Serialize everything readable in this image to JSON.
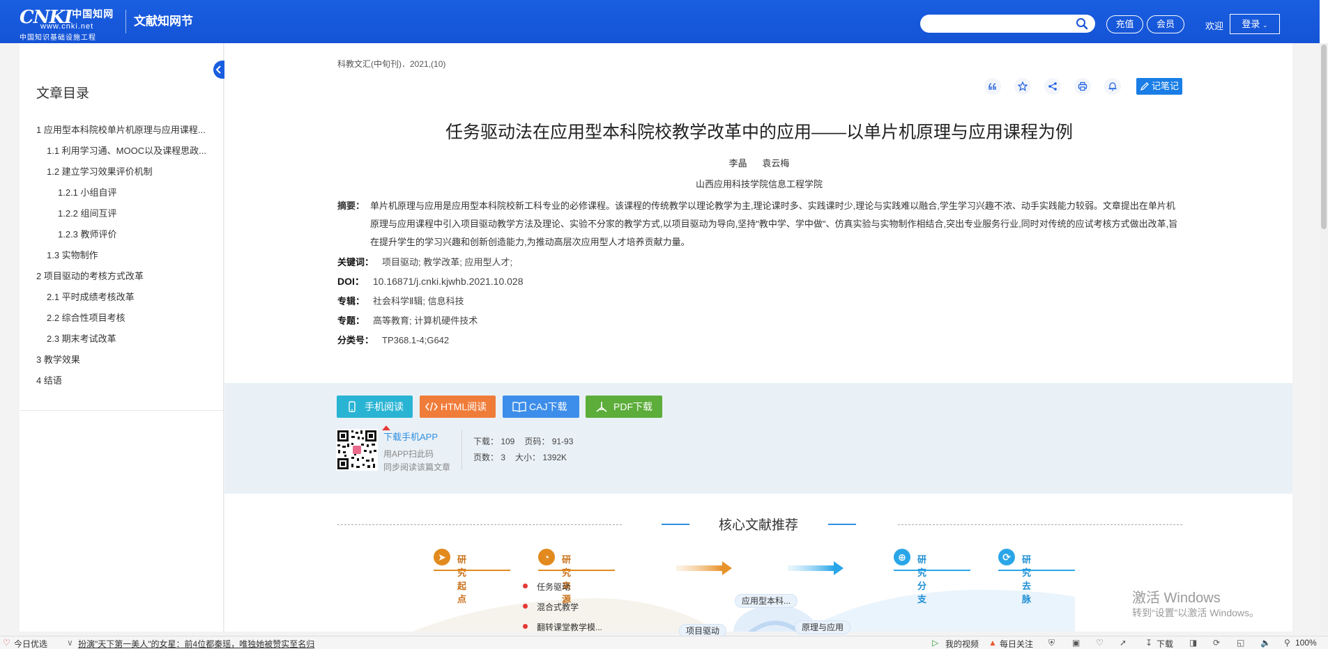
{
  "header": {
    "logo_mark": "CNKI",
    "logo_cn": "中国知网",
    "logo_url": "www.cnki.net",
    "logo_sub": "中国知识基础设施工程",
    "site_name": "文献知网节",
    "search_placeholder": "",
    "recharge_label": "充值",
    "member_label": "会员",
    "welcome_text": "欢迎",
    "login_label": "登录"
  },
  "toc": {
    "title": "文章目录",
    "items": [
      {
        "label": "1 应用型本科院校单片机原理与应用课程...",
        "level": 1
      },
      {
        "label": "1.1 利用学习通、MOOC以及课程思政...",
        "level": 2
      },
      {
        "label": "1.2 建立学习效果评价机制",
        "level": 2
      },
      {
        "label": "1.2.1 小组自评",
        "level": 3
      },
      {
        "label": "1.2.2 组间互评",
        "level": 3
      },
      {
        "label": "1.2.3 教师评价",
        "level": 3
      },
      {
        "label": "1.3 实物制作",
        "level": 2
      },
      {
        "label": "2 项目驱动的考核方式改革",
        "level": 1
      },
      {
        "label": "2.1 平时成绩考核改革",
        "level": 2
      },
      {
        "label": "2.2 综合性项目考核",
        "level": 2
      },
      {
        "label": "2.3 期末考试改革",
        "level": 2
      },
      {
        "label": "3 教学效果",
        "level": 1
      },
      {
        "label": "4 结语",
        "level": 1
      }
    ]
  },
  "article": {
    "source": "科教文汇(中旬刊)．2021,(10)",
    "note_label": "记笔记",
    "title": "任务驱动法在应用型本科院校教学改革中的应用——以单片机原理与应用课程为例",
    "authors": [
      "李晶",
      "袁云梅"
    ],
    "affiliation": "山西应用科技学院信息工程学院",
    "abstract_label": "摘要：",
    "abstract": "单片机原理与应用是应用型本科院校新工科专业的必修课程。该课程的传统教学以理论教学为主,理论课时多、实践课时少,理论与实践难以融合,学生学习兴趣不浓、动手实践能力较弱。文章提出在单片机原理与应用课程中引入项目驱动教学方法及理论、实验不分家的教学方式,以项目驱动为导向,坚持\"教中学、学中做\"、仿真实验与实物制作相结合,突出专业服务行业,同时对传统的应试考核方式做出改革,旨在提升学生的学习兴趣和创新创造能力,为推动高层次应用型人才培养贡献力量。",
    "keywords_label": "关键词：",
    "keywords": "项目驱动;  教学改革;  应用型人才;",
    "doi_label": "DOI：",
    "doi": "10.16871/j.cnki.kjwhb.2021.10.028",
    "series_label": "专辑：",
    "series": "社会科学Ⅱ辑; 信息科技",
    "subject_label": "专题：",
    "subject": "高等教育; 计算机硬件技术",
    "class_label": "分类号：",
    "class": "TP368.1-4;G642"
  },
  "downloads": {
    "mobile_read": "手机阅读",
    "html_read": "HTML阅读",
    "caj_download": "CAJ下载",
    "pdf_download": "PDF下载",
    "app_link": "下载手机APP",
    "app_tip1": "用APP扫此码",
    "app_tip2": "同步阅读该篇文章",
    "downloads_text": "下载：  109",
    "pages_range_text": "页码：  91-93",
    "page_count_text": "页数：  3",
    "size_text": "大小：  1392K"
  },
  "recommend": {
    "title": "核心文献推荐",
    "tab_origin": "研究起点",
    "tab_source": "研究来源",
    "tab_branch": "研究分支",
    "tab_trend": "研究去脉",
    "source_items": [
      "任务驱动",
      "混合式教学",
      "翻转课堂教学模..."
    ],
    "bubble_1": "应用型本科...",
    "bubble_2": "项目驱动",
    "bubble_3": "原理与应用"
  },
  "watermark": {
    "line1": "激活 Windows",
    "line2": "转到“设置”以激活 Windows。"
  },
  "statusbar": {
    "daily_pick": "今日优选",
    "news": "扮演\"天下第一美人\"的女星：前4位都秦瑶，唯独她被赞实至名归",
    "my_video": "我的视频",
    "daily_follow": "每日关注",
    "download": "下载",
    "zoom": "100%"
  },
  "colors": {
    "header_blue": "#1a5ee0",
    "mobile_btn": "#2ab4d3",
    "html_btn": "#f07c3a",
    "caj_btn": "#3d8eea",
    "pdf_btn": "#5cad3a",
    "origin_orange": "#e28a1e",
    "branch_blue": "#2aa6e8"
  }
}
